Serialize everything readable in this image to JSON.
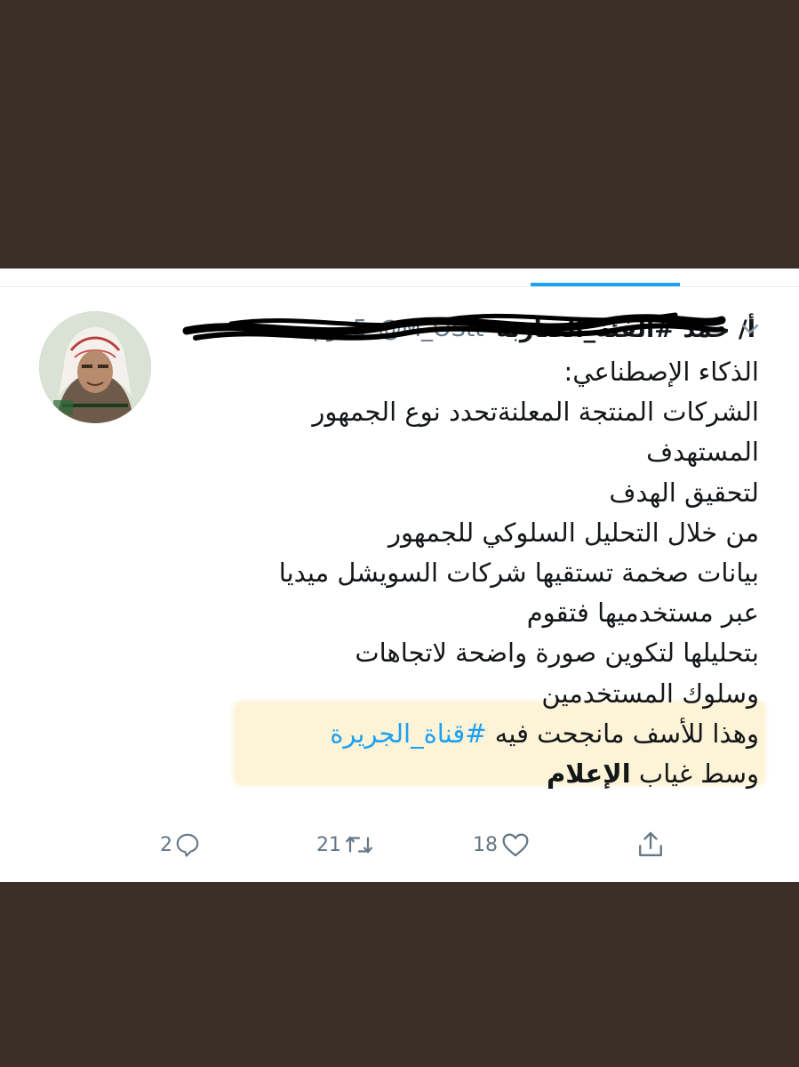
{
  "tweet": {
    "author": {
      "display_name": "أ/ حمد #الفئة_الضاربة",
      "handle": "@M_OStt",
      "avatar": "avatar-photo"
    },
    "date": "5 يوم",
    "lines": [
      "الذكاء الإصطناعي:",
      "الشركات المنتجة المعلنةتحدد نوع الجمهور",
      "المستهدف",
      " لتحقيق الهدف",
      "من خلال التحليل السلوكي للجمهور",
      "بيانات صخمة تستقيها شركات السويشل ميديا",
      "عبر مستخدميها فتقوم",
      "بتحليلها لتكوين صورة واضحة لاتجاهات",
      "وسلوك المستخدمين"
    ],
    "line_hashtag": {
      "prefix": "وهذا للأسف مانجحت فيه ",
      "hashtag": "#قناة_الجريرة"
    },
    "line_last": {
      "prefix": "وسط غياب ",
      "bold": "الإعلام"
    },
    "actions": {
      "reply_count": "2",
      "retweet_count": "21",
      "like_count": "18"
    }
  },
  "icons": {
    "chevron": "chevron-down-icon",
    "reply": "reply-icon",
    "retweet": "retweet-icon",
    "like": "heart-icon",
    "share": "share-icon"
  },
  "colors": {
    "background_frame": "#3b2f28",
    "text": "#14171a",
    "secondary": "#657786",
    "accent": "#1da1f2",
    "highlight": "#fdf3d6"
  }
}
